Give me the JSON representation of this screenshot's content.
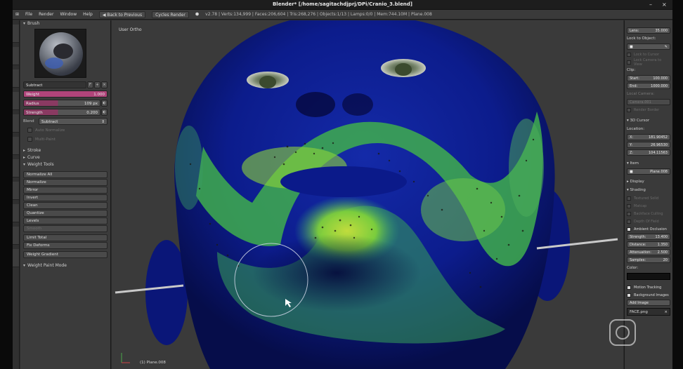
{
  "titlebar": {
    "title": "Blender* [/home/sagitachdjprj/DPi/Cranio_3.blend]",
    "minimize": "–",
    "close": "×"
  },
  "header": {
    "menu": [
      "File",
      "Render",
      "Window",
      "Help"
    ],
    "back_to_previous": "Back to Previous",
    "engine": "Cycles Render",
    "stats": "v2.78 | Verts:134,999 | Faces:206,604 | Tris:268,276 | Objects:1/13 | Lamps:0/0 | Mem:744.10M | Plane.008"
  },
  "toolshelf": {
    "brush_header": "Brush",
    "brush_name": "Subtract",
    "weight": {
      "label": "Weight",
      "value": "1.000"
    },
    "radius": {
      "label": "Radius",
      "value": "109 px"
    },
    "strength": {
      "label": "Strength",
      "value": "0.200"
    },
    "blend": {
      "label": "Blend",
      "value": "Subtract"
    },
    "auto_normalize": "Auto Normalize",
    "multi_paint": "Multi-Paint",
    "sections": {
      "stroke": "Stroke",
      "curve": "Curve",
      "weight_tools": "Weight Tools"
    },
    "tools": [
      "Normalize All",
      "Normalize",
      "Mirror",
      "Invert",
      "Clean",
      "Quantize",
      "Levels",
      "Smooth",
      "Limit Total",
      "Fix Deforms",
      "Weight Gradient"
    ],
    "mode_footer": "Weight Paint Mode"
  },
  "viewport": {
    "view_label": "User Ortho",
    "object_label": "(1) Plane.008"
  },
  "properties": {
    "lens": {
      "label": "Lens:",
      "value": "35.000"
    },
    "lock_to_object": "Lock to Object:",
    "lock_to_cursor": "Lock to Cursor",
    "lock_camera": "Lock Camera to View",
    "clip": "Clip:",
    "start": {
      "label": "Start:",
      "value": "100.000"
    },
    "end": {
      "label": "End:",
      "value": "1000.000"
    },
    "local_camera": "Local Camera:",
    "camera_value": "Camera.001",
    "render_border": "Render Border",
    "cursor_3d": "3D Cursor",
    "location": "Location:",
    "x": {
      "label": "X:",
      "value": "181.90452"
    },
    "y": {
      "label": "Y:",
      "value": "26.96530"
    },
    "z": {
      "label": "Z:",
      "value": "104.11563"
    },
    "item": "Item",
    "item_name": "Plane.008",
    "display": "Display",
    "shading": "Shading",
    "textured_solid": "Textured Solid",
    "matcap": "Matcap",
    "backface_culling": "Backface Culling",
    "depth_of_field": "Depth Of Field",
    "ambient_occlusion": "Ambient Occlusion",
    "ao_strength": {
      "label": "Strength:",
      "value": "13.400"
    },
    "ao_distance": {
      "label": "Distance:",
      "value": "1.350"
    },
    "ao_attenuation": {
      "label": "Attenuation:",
      "value": "2.500"
    },
    "ao_samples": {
      "label": "Samples:",
      "value": "20"
    },
    "color": "Color:",
    "motion_tracking": "Motion Tracking",
    "background_images": "Background Images",
    "add_image": "Add Image",
    "image_name": "FACE.png"
  },
  "colors": {
    "mesh_blue": "#0b1a8a",
    "weight_green": "#7fd23a",
    "weight_yellow": "#c8e03a",
    "pink_field": "#b0447a"
  }
}
